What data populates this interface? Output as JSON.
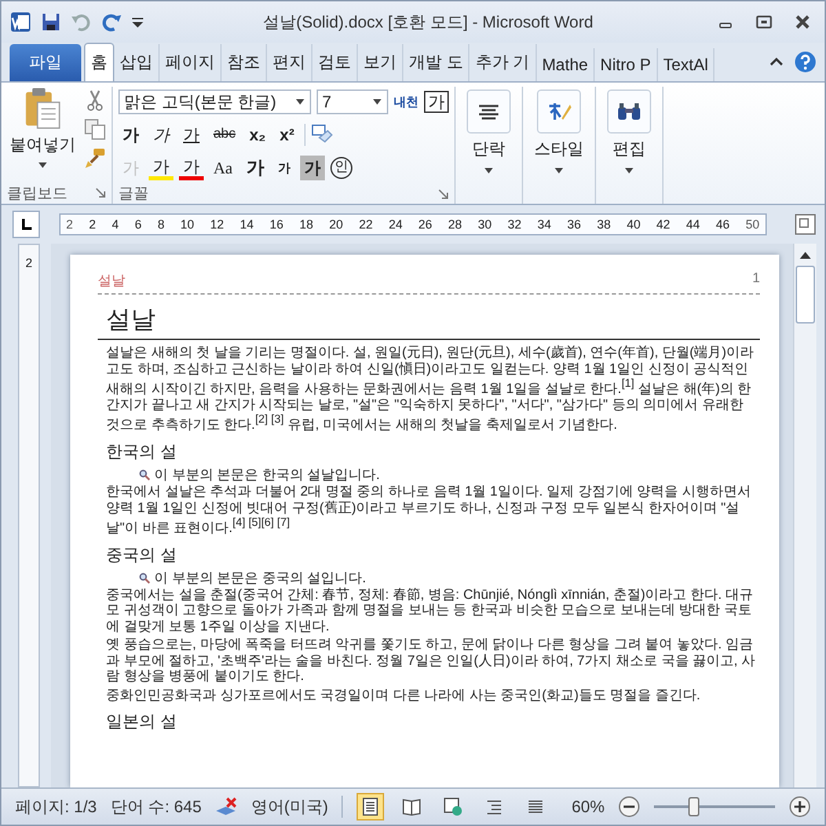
{
  "window": {
    "title": "설날(Solid).docx [호환 모드] - Microsoft Word"
  },
  "tabs": [
    {
      "label": "파일",
      "kind": "file",
      "selected": false
    },
    {
      "label": "홈",
      "kind": "tab",
      "selected": true
    },
    {
      "label": "삽입",
      "kind": "tab",
      "selected": false
    },
    {
      "label": "페이지",
      "kind": "tab",
      "selected": false
    },
    {
      "label": "참조",
      "kind": "tab",
      "selected": false
    },
    {
      "label": "편지",
      "kind": "tab",
      "selected": false
    },
    {
      "label": "검토",
      "kind": "tab",
      "selected": false
    },
    {
      "label": "보기",
      "kind": "tab",
      "selected": false
    },
    {
      "label": "개발 도",
      "kind": "tab",
      "selected": false
    },
    {
      "label": "추가 기",
      "kind": "tab",
      "selected": false
    },
    {
      "label": "Mathe",
      "kind": "tab",
      "selected": false
    },
    {
      "label": "Nitro P",
      "kind": "tab",
      "selected": false
    },
    {
      "label": "TextAl",
      "kind": "tab",
      "selected": false
    }
  ],
  "ribbon": {
    "clipboard": {
      "paste_label": "붙여넣기",
      "group_label": "클립보드"
    },
    "font": {
      "name": "맑은 고딕(본문 한글)",
      "size": "7",
      "phonetic_label": "내천",
      "char_border_label": "가",
      "group_label": "글꼴",
      "row1": [
        {
          "label": "가",
          "kind": "bold",
          "disabled": false
        },
        {
          "label": "가",
          "kind": "italic",
          "disabled": false
        },
        {
          "label": "가",
          "kind": "underline",
          "disabled": false
        },
        {
          "label": "abc",
          "kind": "strike",
          "disabled": false
        },
        {
          "label": "x₂",
          "kind": "script",
          "disabled": false
        },
        {
          "label": "x²",
          "kind": "script",
          "disabled": false
        }
      ],
      "row2": [
        {
          "label": "가",
          "kind": "effect",
          "disabled": true
        },
        {
          "label": "가",
          "kind": "highlight",
          "disabled": false
        },
        {
          "label": "가",
          "kind": "color",
          "disabled": false
        },
        {
          "label": "Aa",
          "kind": "case",
          "disabled": false
        },
        {
          "label": "가",
          "kind": "grow",
          "disabled": false
        },
        {
          "label": "가",
          "kind": "shrink",
          "disabled": false
        },
        {
          "label": "가",
          "kind": "shade",
          "disabled": false
        },
        {
          "label": "인",
          "kind": "enclose",
          "disabled": false
        }
      ]
    },
    "groups": [
      {
        "label": "단락",
        "kind": "paragraph"
      },
      {
        "label": "스타일",
        "kind": "style"
      },
      {
        "label": "편집",
        "kind": "find"
      }
    ]
  },
  "ruler": {
    "ticks": [
      "2",
      "2",
      "4",
      "6",
      "8",
      "10",
      "12",
      "14",
      "16",
      "18",
      "20",
      "22",
      "24",
      "26",
      "28",
      "30",
      "32",
      "34",
      "36",
      "38",
      "40",
      "42",
      "44",
      "46",
      "50"
    ],
    "vertical_label": "2"
  },
  "document": {
    "header_text": "설날",
    "page_number": "1",
    "title": "설날",
    "intro": "설날은 새해의 첫 날을 기리는 명절이다. 설, 원일(元日), 원단(元旦), 세수(歲首), 연수(年首), 단월(端月)이라고도 하며, 조심하고 근신하는 날이라 하여 신일(愼日)이라고도 일컫는다. 양력 1월 1일인 신정이 공식적인 새해의 시작이긴 하지만, 음력을 사용하는 문화권에서는 음력 1월 1일을 설날로 한다.$^{[1]}$ 설날은 해(年)의 한 간지가 끝나고 새 간지가 시작되는 날로, \"설\"은 \"익숙하지 못하다\", \"서다\", \"삼가다\" 등의 의미에서 유래한 것으로 추측하기도 한다.$^{[2] [3]}$ 유럽, 미국에서는 새해의 첫날을 축제일로서 기념한다.",
    "sections": [
      {
        "heading": "한국의 설",
        "note": "이 부분의 본문은 한국의 설날입니다.",
        "paragraphs": [
          "한국에서 설날은 추석과 더불어 2대 명절 중의 하나로 음력 1월 1일이다. 일제 강점기에 양력을 시행하면서 양력 1월 1일인 신정에 빗대어 구정(舊正)이라고 부르기도 하나, 신정과 구정 모두 일본식 한자어이며 \"설날\"이 바른 표현이다.$^{[4] [5][6] [7]}$"
        ]
      },
      {
        "heading": "중국의 설",
        "note": "이 부분의 본문은 중국의 설입니다.",
        "paragraphs": [
          "중국에서는 설을 춘절(중국어 간체: 春节, 정체: 春節, 병음: Chūnjié, Nónglì xīnnián, 춘절)이라고 한다. 대규모 귀성객이 고향으로 돌아가 가족과 함께 명절을 보내는 등 한국과 비슷한 모습으로 보내는데 방대한 국토에 걸맞게 보통 1주일 이상을 지낸다.",
          "옛 풍습으로는, 마당에 폭죽을 터뜨려 악귀를 쫓기도 하고, 문에 닭이나 다른 형상을 그려 붙여 놓았다. 임금과 부모에 절하고, '초백주'라는 술을 바친다. 정월 7일은 인일(人日)이라 하여, 7가지 채소로 국을 끓이고, 사람 형상을 병풍에 붙이기도 한다.",
          "중화인민공화국과 싱가포르에서도 국경일이며 다른 나라에 사는 중국인(화교)들도 명절을 즐긴다."
        ]
      },
      {
        "heading": "일본의 설"
      }
    ]
  },
  "status_bar": {
    "page": "페이지: 1/3",
    "words": "단어 수: 645",
    "language": "영어(미국)",
    "views": [
      {
        "kind": "print",
        "selected": true
      },
      {
        "kind": "reading",
        "selected": false
      },
      {
        "kind": "web",
        "selected": false
      },
      {
        "kind": "outline",
        "selected": false
      },
      {
        "kind": "draft",
        "selected": false
      }
    ],
    "zoom": "60%",
    "zoom_slider": {
      "level": 0.33
    }
  }
}
